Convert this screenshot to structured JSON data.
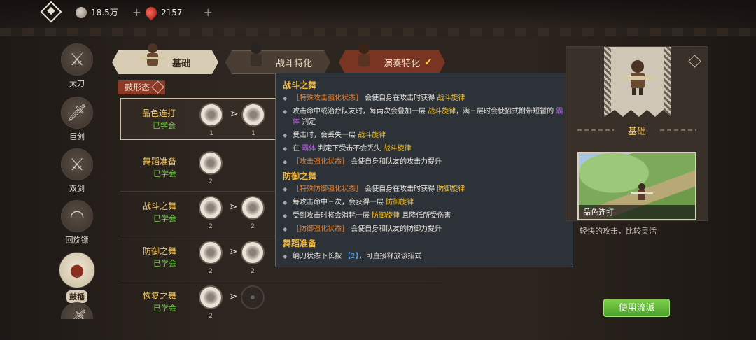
{
  "currency": {
    "coins": "18.5万",
    "gems": "2157"
  },
  "weapons": [
    {
      "label": "太刀",
      "icon": "long-sword-icon"
    },
    {
      "label": "巨剑",
      "icon": "great-sword-icon"
    },
    {
      "label": "双剑",
      "icon": "dual-blades-icon"
    },
    {
      "label": "回旋镖",
      "icon": "boomerang-icon"
    },
    {
      "label": "鼓锤",
      "icon": "drum-hammer-icon",
      "active": true
    }
  ],
  "tabs": [
    {
      "label": "基础",
      "active": true
    },
    {
      "label": "战斗特化"
    },
    {
      "label": "演奏特化",
      "checked": true
    }
  ],
  "form_label": "鼓形态",
  "skills": [
    {
      "name": "品色连打",
      "state": "已学会",
      "nodes": [
        "1",
        "1"
      ],
      "selected": true
    },
    {
      "name": "舞蹈准备",
      "state": "已学会",
      "nodes": [
        "2"
      ]
    },
    {
      "name": "战斗之舞",
      "state": "已学会",
      "nodes": [
        "2",
        "2"
      ]
    },
    {
      "name": "防御之舞",
      "state": "已学会",
      "nodes": [
        "2",
        "2"
      ]
    },
    {
      "name": "恢复之舞",
      "state": "已学会",
      "nodes": [
        "2",
        ""
      ]
    }
  ],
  "tooltip": {
    "h1": "战斗之舞",
    "l1": {
      "tag": "［特殊攻击强化状态］",
      "t": "会使自身在攻击时获得",
      "k": "战斗旋律"
    },
    "l2": {
      "a": "攻击命中或治疗队友时，每两次会叠加一层",
      "k": "战斗旋律",
      "b": "，满三层时会使招式附带短暂的",
      "p": "霸体",
      "c": "判定"
    },
    "l3": {
      "a": "受击时，会丢失一层",
      "k": "战斗旋律"
    },
    "l4": {
      "a": "在",
      "p": "霸体",
      "b": "判定下受击不会丢失",
      "k": "战斗旋律"
    },
    "l5": {
      "tag": "［攻击强化状态］",
      "t": "会使自身和队友的攻击力提升"
    },
    "h2": "防御之舞",
    "l6": {
      "tag": "［特殊防御强化状态］",
      "t": "会使自身在攻击时获得",
      "k": "防御旋律"
    },
    "l7": {
      "a": "每攻击命中三次，会获得一层",
      "k": "防御旋律"
    },
    "l8": {
      "a": "受到攻击时将会消耗一层",
      "k": "防御旋律",
      "b": "且降低所受伤害"
    },
    "l9": {
      "tag": "［防御强化状态］",
      "t": "会使自身和队友的防御力提升"
    },
    "h3": "舞蹈准备",
    "l10": {
      "a": "纳刀状态下长按",
      "b": "【2】",
      "c": "，可直接释放该招式"
    }
  },
  "preview": {
    "title": "基础",
    "caption": "品色连打",
    "description": "轻快的攻击，比较灵活"
  },
  "use_button": "使用流派"
}
